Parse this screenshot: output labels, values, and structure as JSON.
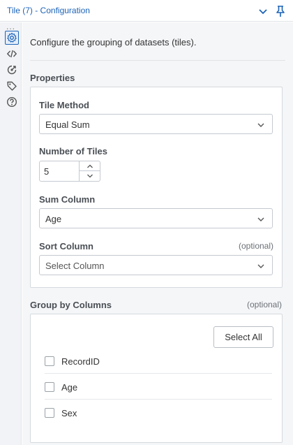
{
  "window": {
    "title": "Tile (7) - Configuration"
  },
  "description": "Configure the grouping of datasets (tiles).",
  "properties": {
    "title": "Properties",
    "tile_method": {
      "label": "Tile Method",
      "value": "Equal Sum"
    },
    "number_of_tiles": {
      "label": "Number of Tiles",
      "value": "5"
    },
    "sum_column": {
      "label": "Sum Column",
      "value": "Age"
    },
    "sort_column": {
      "label": "Sort Column",
      "optional": "(optional)",
      "placeholder": "Select Column"
    }
  },
  "group_by": {
    "title": "Group by Columns",
    "optional": "(optional)",
    "select_all": "Select All",
    "columns": [
      {
        "name": "RecordID",
        "checked": false
      },
      {
        "name": "Age",
        "checked": false
      },
      {
        "name": "Sex",
        "checked": false
      }
    ]
  },
  "side_rail": {
    "dots": "...",
    "icons": [
      "gear-icon",
      "code-icon",
      "target-icon",
      "tag-icon",
      "help-icon"
    ]
  },
  "colors": {
    "accent": "#1c63b7",
    "panel_bg": "#f5f6f8",
    "border": "#d5d9de"
  }
}
